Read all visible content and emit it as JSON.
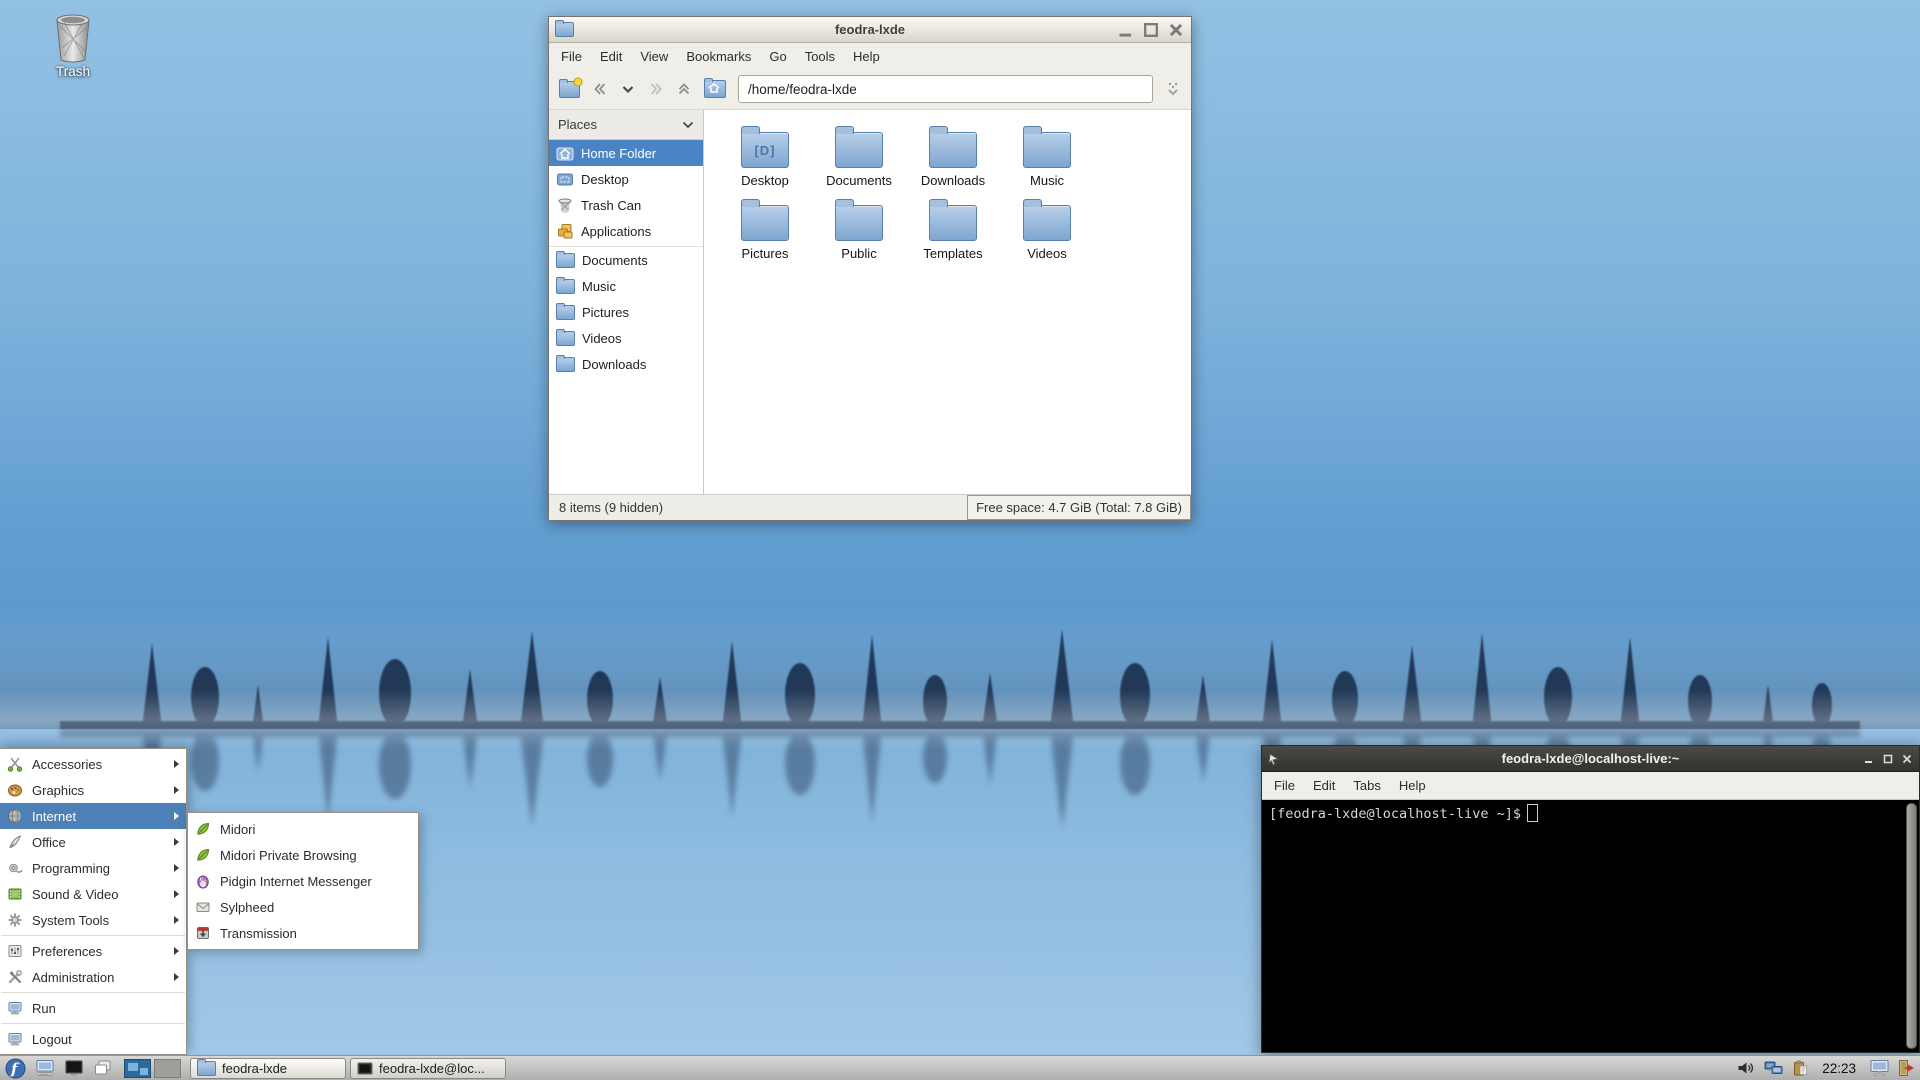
{
  "desktop": {
    "trash_label": "Trash"
  },
  "file_manager": {
    "title": "feodra-lxde",
    "menu": [
      "File",
      "Edit",
      "View",
      "Bookmarks",
      "Go",
      "Tools",
      "Help"
    ],
    "path": "/home/feodra-lxde",
    "places_header": "Places",
    "places": [
      {
        "label": "Home Folder"
      },
      {
        "label": "Desktop"
      },
      {
        "label": "Trash Can"
      },
      {
        "label": "Applications"
      },
      {
        "label": "Documents"
      },
      {
        "label": "Music"
      },
      {
        "label": "Pictures"
      },
      {
        "label": "Videos"
      },
      {
        "label": "Downloads"
      }
    ],
    "folders": [
      "Desktop",
      "Documents",
      "Downloads",
      "Music",
      "Pictures",
      "Public",
      "Templates",
      "Videos"
    ],
    "status_left": "8 items (9 hidden)",
    "status_right": "Free space: 4.7 GiB (Total: 7.8 GiB)"
  },
  "app_menu": {
    "items": [
      "Accessories",
      "Graphics",
      "Internet",
      "Office",
      "Programming",
      "Sound & Video",
      "System Tools",
      "Preferences",
      "Administration",
      "Run",
      "Logout"
    ],
    "selected": "Internet"
  },
  "internet_submenu": [
    "Midori",
    "Midori Private Browsing",
    "Pidgin Internet Messenger",
    "Sylpheed",
    "Transmission"
  ],
  "terminal": {
    "title": "feodra-lxde@localhost-live:~",
    "menu": [
      "File",
      "Edit",
      "Tabs",
      "Help"
    ],
    "prompt": "[feodra-lxde@localhost-live ~]$"
  },
  "taskbar": {
    "tasks": [
      {
        "label": "feodra-lxde"
      },
      {
        "label": "feodra-lxde@loc..."
      }
    ],
    "clock": "22:23"
  },
  "colors": {
    "selection_blue": "#4b84c4",
    "menu_highlight": "#4d80b6",
    "titlebar_beige": "#d9d5ca",
    "terminal_titlebar": "#3b3a36",
    "folder_blue": "#7ea6d0",
    "desktop_sky": "#6ca6d6"
  }
}
